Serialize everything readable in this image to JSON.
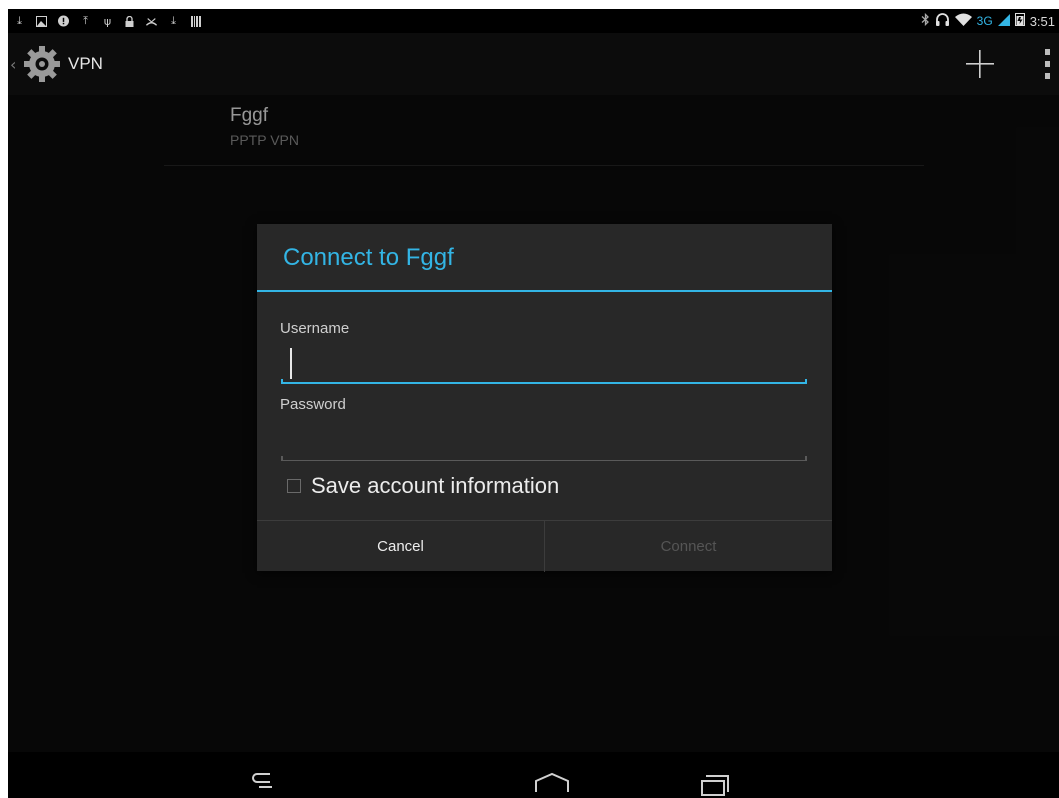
{
  "status_bar": {
    "network_label": "3G",
    "time": "3:51"
  },
  "action_bar": {
    "title": "VPN",
    "app_icon": "settings-gear-icon",
    "add_icon": "plus-icon",
    "overflow_icon": "overflow-menu-icon"
  },
  "vpn_list": [
    {
      "name": "Fggf",
      "type": "PPTP VPN"
    }
  ],
  "dialog": {
    "title": "Connect to Fggf",
    "username_label": "Username",
    "username_value": "",
    "password_label": "Password",
    "password_value": "",
    "save_label": "Save account information",
    "save_checked": false,
    "cancel_label": "Cancel",
    "connect_label": "Connect"
  },
  "colors": {
    "accent": "#33b5e5",
    "background": "#0c0c0c",
    "dialog_background": "#282828",
    "disabled_text": "#555555"
  }
}
